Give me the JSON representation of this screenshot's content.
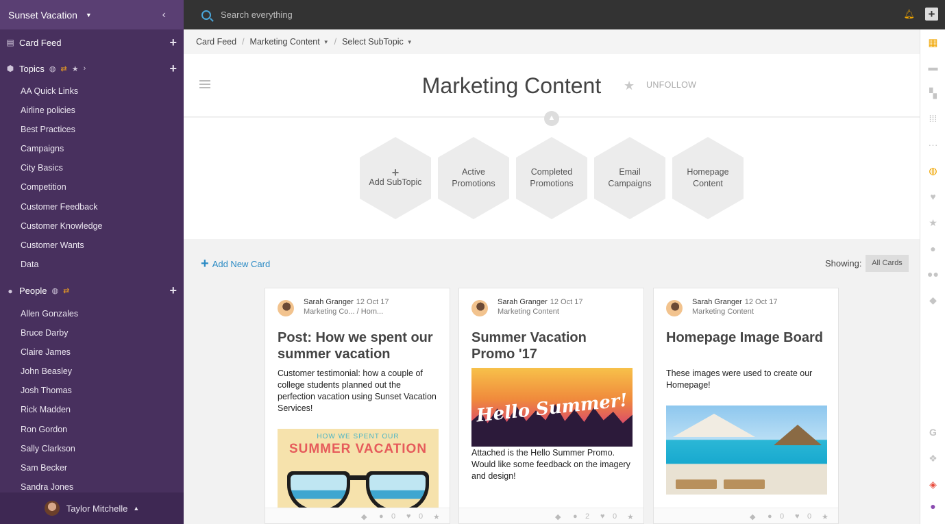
{
  "sidebar": {
    "team_name": "Sunset Vacation",
    "card_feed_label": "Card Feed",
    "topics_label": "Topics",
    "topics": [
      "AA Quick Links",
      "Airline policies",
      "Best Practices",
      "Campaigns",
      "City Basics",
      "Competition",
      "Customer Feedback",
      "Customer Knowledge",
      "Customer Wants",
      "Data"
    ],
    "people_label": "People",
    "people": [
      "Allen Gonzales",
      "Bruce Darby",
      "Claire James",
      "John Beasley",
      "Josh Thomas",
      "Rick Madden",
      "Ron Gordon",
      "Sally Clarkson",
      "Sam Becker",
      "Sandra Jones"
    ],
    "user_name": "Taylor Mitchelle"
  },
  "topbar": {
    "search_placeholder": "Search everything"
  },
  "breadcrumb": {
    "items": [
      "Card Feed",
      "Marketing Content",
      "Select SubTopic"
    ]
  },
  "topic": {
    "title": "Marketing Content",
    "unfollow_label": "UNFOLLOW"
  },
  "subtopics": {
    "add_label": "Add SubTopic",
    "items": [
      "Active Promotions",
      "Completed Promotions",
      "Email Campaigns",
      "Homepage Content"
    ]
  },
  "cards_toolbar": {
    "add_label": "Add New Card",
    "showing_label": "Showing:",
    "filter_value": "All Cards"
  },
  "cards": [
    {
      "author": "Sarah Granger",
      "date": "12 Oct 17",
      "path": "Marketing Co... / Hom...",
      "title": "Post: How we spent our summer vacation",
      "body": "Customer testimonial: how a couple of college students planned out the perfection vacation using Sunset Vacation Services!",
      "image_text_top": "HOW WE SPENT OUR",
      "image_text_main": "SUMMER VACATION",
      "comments": "0",
      "likes": "0"
    },
    {
      "author": "Sarah Granger",
      "date": "12 Oct 17",
      "path": "Marketing Content",
      "title": "Summer Vacation Promo '17",
      "image_text": "Hello Summer!",
      "body": "Attached is the Hello Summer Promo. Would like some feedback on the imagery and design!",
      "comments": "2",
      "likes": "0"
    },
    {
      "author": "Sarah Granger",
      "date": "12 Oct 17",
      "path": "Marketing Content",
      "title": "Homepage Image Board",
      "body": "These images were used to create our Homepage!",
      "comments": "0",
      "likes": "0"
    }
  ],
  "colors": {
    "sidebar": "#48305e",
    "topbar": "#333333",
    "accent": "#2a8ac4",
    "notification": "#f0a500"
  }
}
